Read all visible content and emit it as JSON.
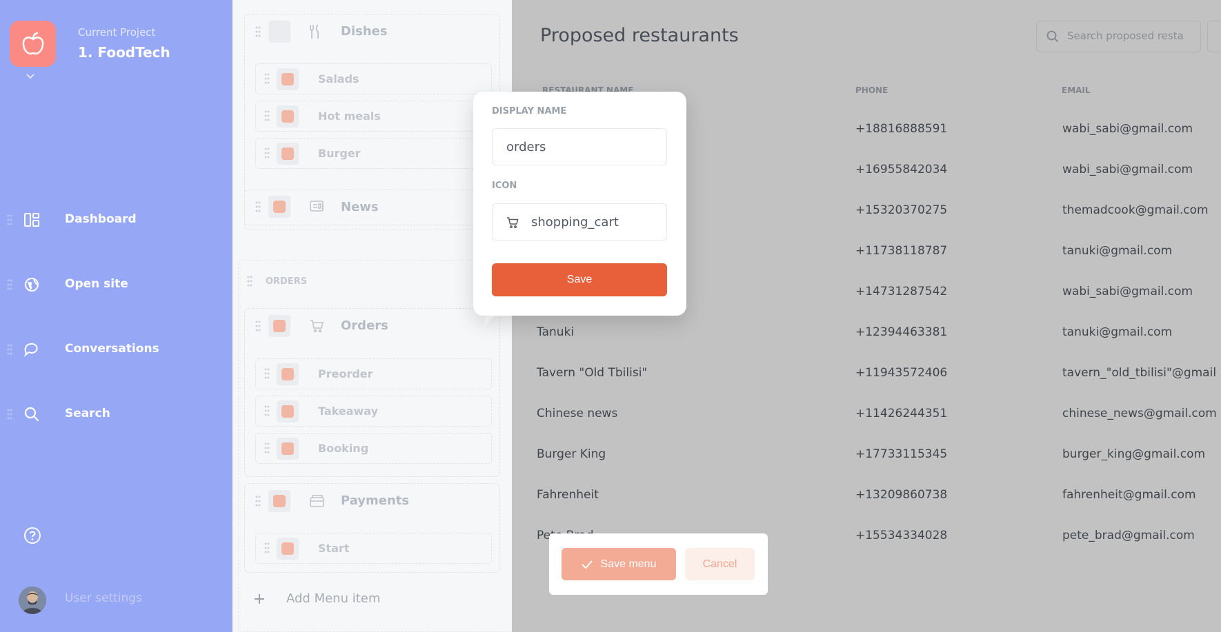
{
  "project": {
    "label": "Current Project",
    "name": "1. FoodTech"
  },
  "sidebar": {
    "items": [
      {
        "label": "Dashboard",
        "icon": "dashboard-icon"
      },
      {
        "label": "Open site",
        "icon": "globe-icon"
      },
      {
        "label": "Conversations",
        "icon": "chat-icon"
      },
      {
        "label": "Search",
        "icon": "search-icon"
      }
    ],
    "user_settings": "User settings"
  },
  "menu_editor": {
    "dishes": {
      "label": "Dishes",
      "children": [
        "Salads",
        "Hot meals",
        "Burger"
      ]
    },
    "news": {
      "label": "News"
    },
    "orders_section": {
      "label": "ORDERS"
    },
    "orders": {
      "label": "Orders",
      "children": [
        "Preorder",
        "Takeaway",
        "Booking"
      ]
    },
    "payments": {
      "label": "Payments",
      "children": [
        "Start"
      ]
    },
    "add_item": "Add Menu item"
  },
  "content": {
    "title": "Proposed restaurants",
    "search_placeholder": "Search proposed restaurants",
    "columns": [
      "RESTAURANT NAME",
      "PHONE",
      "EMAIL"
    ],
    "rows": [
      {
        "name": "",
        "phone": "+18816888591",
        "email": "wabi_sabi@gmail.com"
      },
      {
        "name": "",
        "phone": "+16955842034",
        "email": "wabi_sabi@gmail.com"
      },
      {
        "name": "",
        "phone": "+15320370275",
        "email": "themadcook@gmail.com"
      },
      {
        "name": "",
        "phone": "+11738118787",
        "email": "tanuki@gmail.com"
      },
      {
        "name": "",
        "phone": "+14731287542",
        "email": "wabi_sabi@gmail.com"
      },
      {
        "name": "Tanuki",
        "phone": "+12394463381",
        "email": "tanuki@gmail.com"
      },
      {
        "name": "Tavern \"Old Tbilisi\"",
        "phone": "+11943572406",
        "email": "tavern_\"old_tbilisi\"@gmail"
      },
      {
        "name": "Chinese news",
        "phone": "+11426244351",
        "email": "chinese_news@gmail.com"
      },
      {
        "name": "Burger King",
        "phone": "+17733115345",
        "email": "burger_king@gmail.com"
      },
      {
        "name": "Fahrenheit",
        "phone": "+13209860738",
        "email": "fahrenheit@gmail.com"
      },
      {
        "name": "Pete Brad",
        "phone": "+15534334028",
        "email": "pete_brad@gmail.com"
      }
    ]
  },
  "popover": {
    "display_name_label": "DISPLAY NAME",
    "display_name_value": "orders",
    "icon_label": "ICON",
    "icon_value": "shopping_cart",
    "save_label": "Save"
  },
  "save_bar": {
    "save_label": "Save menu",
    "cancel_label": "Cancel"
  },
  "colors": {
    "sidebar": "#95a7f5",
    "accent": "#e8603a",
    "logo": "#fa8a83"
  }
}
